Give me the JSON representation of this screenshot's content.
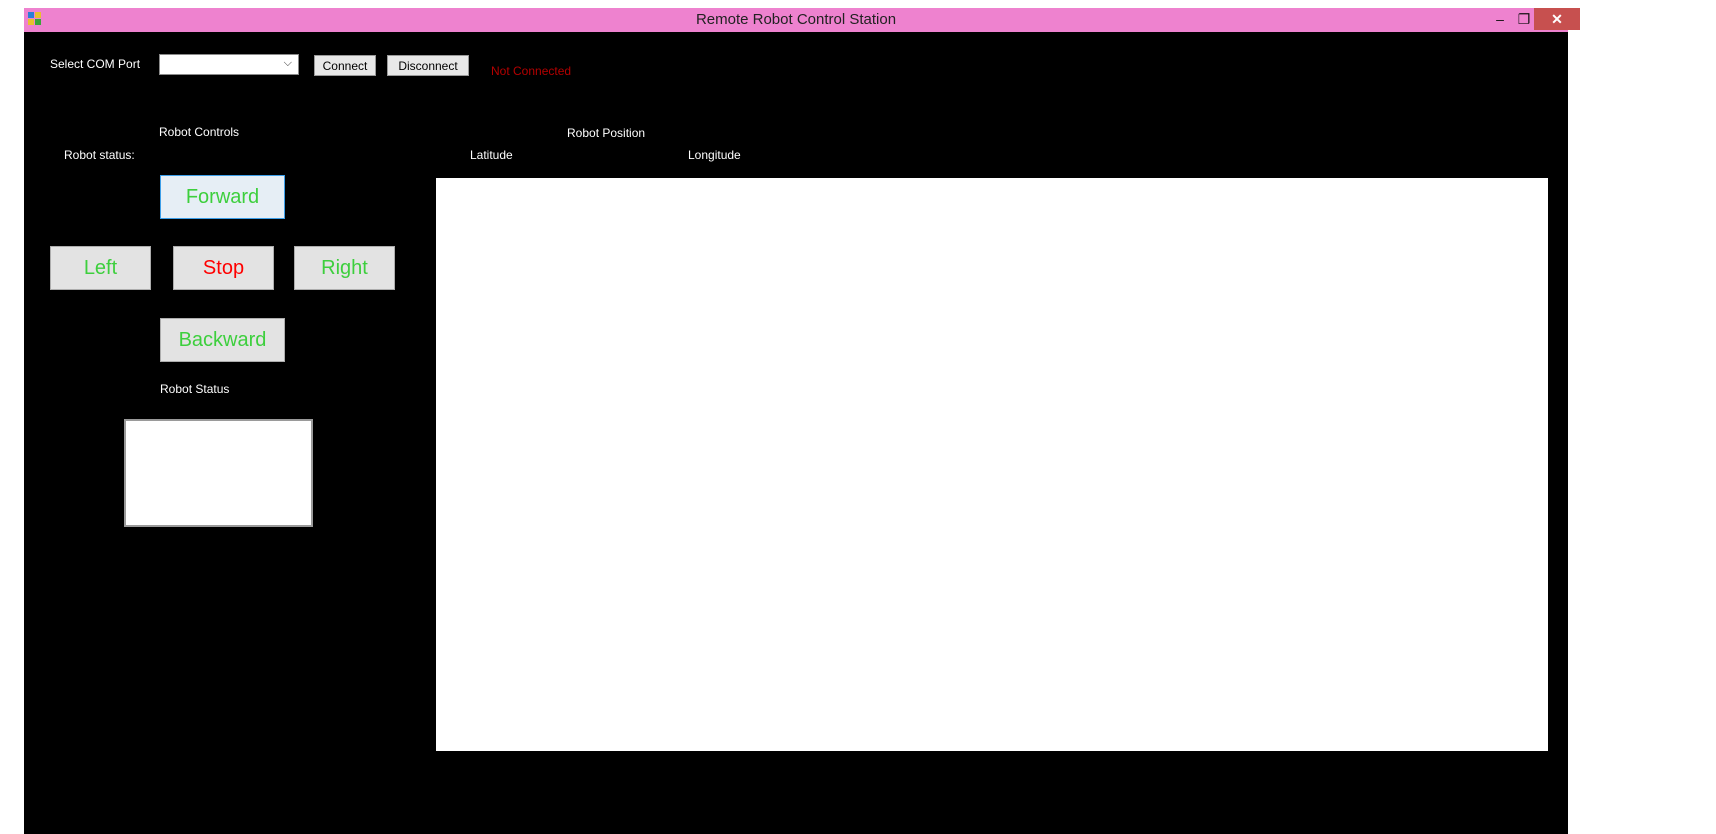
{
  "window": {
    "title": "Remote Robot Control Station",
    "controls": {
      "minimize": "–",
      "restore": "❐",
      "close": "✕"
    }
  },
  "connection": {
    "com_label": "Select COM Port",
    "com_value": "",
    "connect_label": "Connect",
    "disconnect_label": "Disconnect",
    "status_text": "Not Connected"
  },
  "controls": {
    "header": "Robot Controls",
    "robot_status_label": "Robot status:",
    "forward": "Forward",
    "left": "Left",
    "stop": "Stop",
    "right": "Right",
    "backward": "Backward",
    "status_header": "Robot Status"
  },
  "position": {
    "header": "Robot Position",
    "latitude_label": "Latitude",
    "longitude_label": "Longitude"
  },
  "colors": {
    "titlebar": "#ee82cf",
    "background": "#000000",
    "move_text": "#3dcf3d",
    "stop_text": "#ff0000",
    "not_connected": "#b40000",
    "close_button": "#c7504f"
  }
}
